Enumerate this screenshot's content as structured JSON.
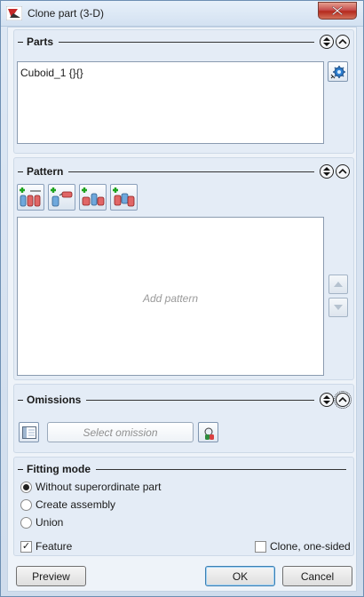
{
  "window": {
    "title": "Clone part (3-D)",
    "app_icon": "hicad-logo-icon",
    "close_icon": "close-x-icon"
  },
  "parts": {
    "title": "Parts",
    "value": "Cuboid_1 {}{}",
    "pick_icon": "gear-pick-icon"
  },
  "pattern": {
    "title": "Pattern",
    "placeholder": "Add pattern",
    "tools": [
      "add-linear-pattern-icon",
      "add-rotated-pattern-icon",
      "add-mirror-pattern-icon",
      "add-grid-pattern-icon"
    ],
    "move_up_icon": "triangle-up-icon",
    "move_down_icon": "triangle-down-icon"
  },
  "omissions": {
    "title": "Omissions",
    "select_label": "Select omission",
    "list_icon": "list-panel-icon",
    "pick_icon": "gear-pick-icon"
  },
  "fitting_mode": {
    "title": "Fitting mode",
    "options": [
      "Without superordinate part",
      "Create assembly",
      "Union"
    ],
    "selected": "Without superordinate part",
    "feature_label": "Feature",
    "feature_checked": true,
    "clone_one_sided_label": "Clone, one-sided",
    "clone_one_sided_checked": false
  },
  "buttons": {
    "preview": "Preview",
    "ok": "OK",
    "cancel": "Cancel"
  }
}
